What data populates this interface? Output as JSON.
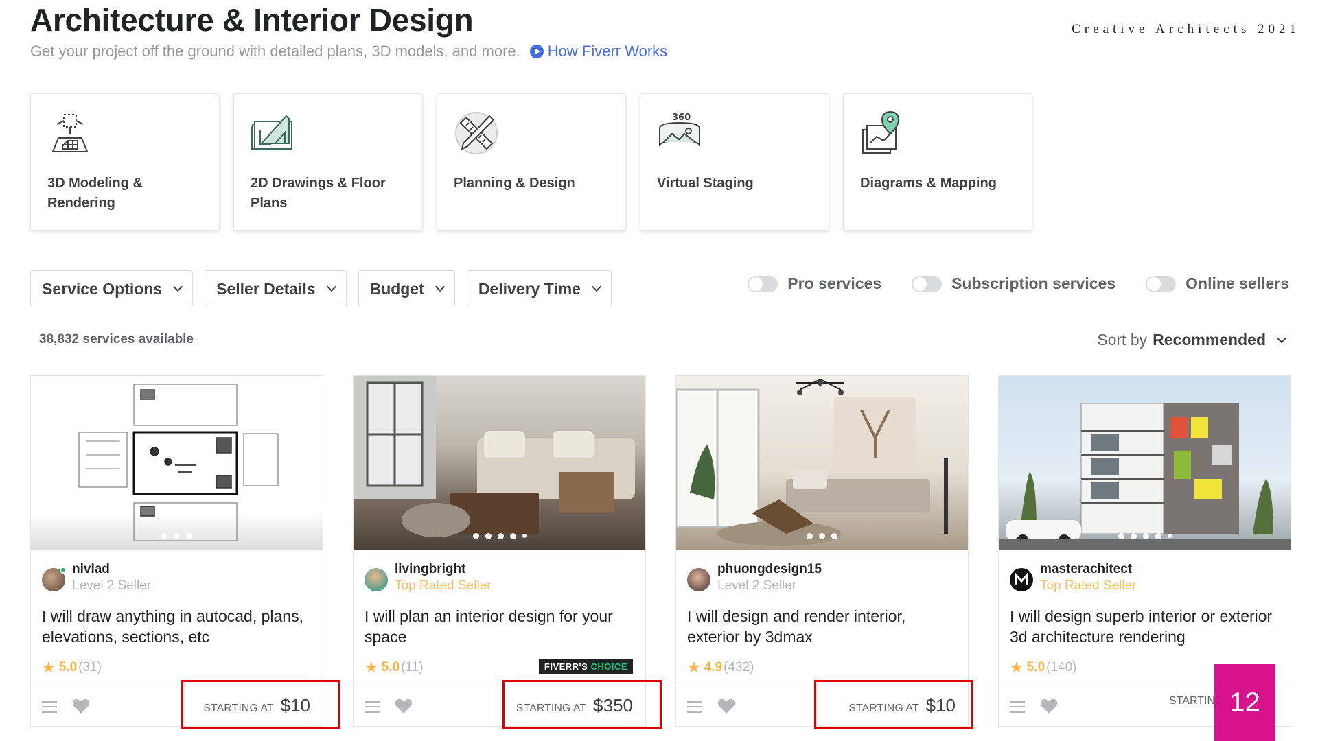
{
  "header": {
    "title": "Architecture & Interior Design",
    "subtitle": "Get your project off the ground with detailed plans, 3D models, and more.",
    "how_link": "How Fiverr Works",
    "brand_tag": "Creative Architects 2021"
  },
  "categories": [
    {
      "label": "3D Modeling & Rendering",
      "icon": "3d-modeling-icon"
    },
    {
      "label": "2D Drawings & Floor Plans",
      "icon": "blueprint-icon"
    },
    {
      "label": "Planning & Design",
      "icon": "ruler-pencil-icon"
    },
    {
      "label": "Virtual Staging",
      "icon": "360-view-icon"
    },
    {
      "label": "Diagrams & Mapping",
      "icon": "map-pin-icon"
    }
  ],
  "filters": {
    "service_options": "Service Options",
    "seller_details": "Seller Details",
    "budget": "Budget",
    "delivery_time": "Delivery Time"
  },
  "toggles": {
    "pro": "Pro services",
    "subscription": "Subscription services",
    "online": "Online sellers"
  },
  "results": {
    "count": "38,832 services available",
    "sort_label": "Sort by",
    "sort_value": "Recommended"
  },
  "gigs": [
    {
      "seller": "nivlad",
      "level": "Level 2 Seller",
      "title": "I will draw anything in autocad, plans, elevations, sections, etc",
      "rating": "5.0",
      "reviews": "(31)",
      "price_label": "STARTING AT",
      "price": "$10"
    },
    {
      "seller": "livingbright",
      "level": "Top Rated Seller",
      "title": "I will plan an interior design for your space",
      "rating": "5.0",
      "reviews": "(11)",
      "badge_a": "FIVERR'S",
      "badge_b": "CHOICE",
      "price_label": "STARTING AT",
      "price": "$350"
    },
    {
      "seller": "phuongdesign15",
      "level": "Level 2 Seller",
      "title": "I will design and render interior, exterior by 3dmax",
      "rating": "4.9",
      "reviews": "(432)",
      "price_label": "STARTING AT",
      "price": "$10"
    },
    {
      "seller": "masterachitect",
      "level": "Top Rated Seller",
      "title": "I will design superb interior or exterior 3d architecture rendering",
      "rating": "5.0",
      "reviews": "(140)",
      "price_label": "STARTIN"
    }
  ],
  "page_number": "12",
  "colors": {
    "accent_blue": "#446ee7",
    "star": "#ffb33e",
    "top_rated": "#ffbe5b",
    "highlight": "#e00000",
    "page_badge": "#d8118c"
  }
}
